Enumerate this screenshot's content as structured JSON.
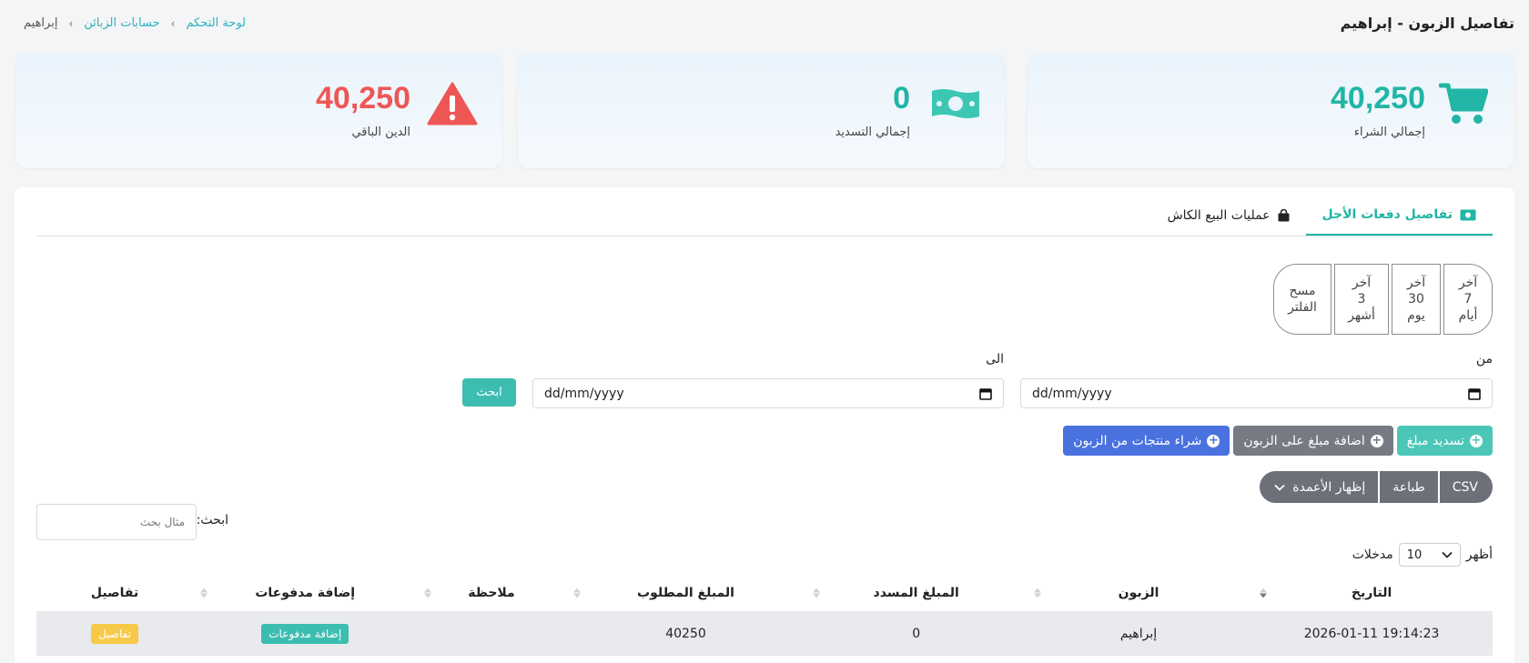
{
  "page": {
    "title": "تفاصيل الزبون - إبراهيم"
  },
  "breadcrumb": {
    "home": "لوحة التحكم",
    "accounts": "حسابات الزبائن",
    "current": "إبراهيم",
    "separator": "›"
  },
  "stats": {
    "total_purchase": {
      "value": "40,250",
      "label": "إجمالي الشراء",
      "icon": "cart-icon",
      "color": "#21b5a5"
    },
    "total_payment": {
      "value": "0",
      "label": "إجمالي التسديد",
      "icon": "money-icon",
      "color": "#21b5a5"
    },
    "remaining_debt": {
      "value": "40,250",
      "label": "الدين الباقي",
      "icon": "warning-icon",
      "color": "#ee5656"
    }
  },
  "tabs": {
    "credit": "تفاصيل دفعات الأجل",
    "cash": "عمليات البيع الكاش"
  },
  "ranges": {
    "last7": "آخر\n7\nأيام",
    "last30": "آخر\n30\nيوم",
    "last3m": "آخر\n3\nأشهر",
    "clear": "مسح\nالفلتر"
  },
  "filters": {
    "from_label": "من",
    "to_label": "الى",
    "from_value": "dd/mm/yyyy",
    "to_value": "dd/mm/yyyy",
    "search_button": "ابحث"
  },
  "actions": {
    "pay": "تسديد مبلغ",
    "add_amount": "اضافة مبلغ على الزبون",
    "buy_products": "شراء منتجات من الزبون"
  },
  "export": {
    "csv": "CSV",
    "print": "طباعة",
    "columns": "إظهار الأعمدة"
  },
  "table_search": {
    "label": "ابحث:",
    "placeholder": "مثال بحث"
  },
  "length": {
    "prefix": "أظهر",
    "value": "10",
    "suffix": "مدخلات"
  },
  "table": {
    "headers": [
      "التاريخ",
      "الزبون",
      "المبلغ المسدد",
      "المبلغ المطلوب",
      "ملاحظة",
      "إضافة مدفوعات",
      "تفاصيل"
    ],
    "rows": [
      {
        "date": "2026-01-11 19:14:23",
        "customer": "إبراهيم",
        "paid": "0",
        "required": "40250",
        "note": "",
        "add_payment": "إضافة مدفوعات",
        "details": "تفاصيل"
      }
    ]
  },
  "colors": {
    "accent": "#21b5a5",
    "danger": "#ee5656",
    "primary_blue": "#4a72de",
    "gray_button": "#767b83",
    "badge_yellow": "#f7c948"
  }
}
